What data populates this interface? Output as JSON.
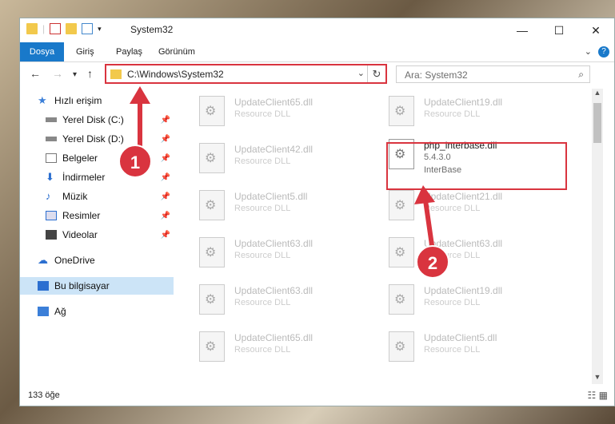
{
  "window": {
    "title": "System32"
  },
  "ribbon": {
    "tabs": [
      "Dosya",
      "Giriş",
      "Paylaş",
      "Görünüm"
    ]
  },
  "address": {
    "path": "C:\\Windows\\System32"
  },
  "search": {
    "placeholder": "Ara: System32"
  },
  "sidebar": {
    "items": [
      {
        "label": "Hızlı erişim"
      },
      {
        "label": "Yerel Disk (C:)"
      },
      {
        "label": "Yerel Disk (D:)"
      },
      {
        "label": "Belgeler"
      },
      {
        "label": "İndirmeler"
      },
      {
        "label": "Müzik"
      },
      {
        "label": "Resimler"
      },
      {
        "label": "Videolar"
      },
      {
        "label": "OneDrive"
      },
      {
        "label": "Bu bilgisayar"
      },
      {
        "label": "Ağ"
      }
    ]
  },
  "files": [
    {
      "name": "UpdateClient65.dll",
      "desc": "Resource DLL"
    },
    {
      "name": "UpdateClient19.dll",
      "desc": "Resource DLL"
    },
    {
      "name": "UpdateClient42.dll",
      "desc": "Resource DLL"
    },
    {
      "name": "php_interbase.dll",
      "desc": "5.4.3.0",
      "extra": "InterBase"
    },
    {
      "name": "UpdateClient5.dll",
      "desc": "Resource DLL"
    },
    {
      "name": "UpdateClient21.dll",
      "desc": "Resource DLL"
    },
    {
      "name": "UpdateClient63.dll",
      "desc": "Resource DLL"
    },
    {
      "name": "UpdateClient63.dll",
      "desc": "Resource DLL"
    },
    {
      "name": "UpdateClient63.dll",
      "desc": "Resource DLL"
    },
    {
      "name": "UpdateClient19.dll",
      "desc": "Resource DLL"
    },
    {
      "name": "UpdateClient65.dll",
      "desc": "Resource DLL"
    },
    {
      "name": "UpdateClient5.dll",
      "desc": "Resource DLL"
    }
  ],
  "status": {
    "count": "133 öğe"
  },
  "annotations": {
    "step1": "1",
    "step2": "2"
  }
}
